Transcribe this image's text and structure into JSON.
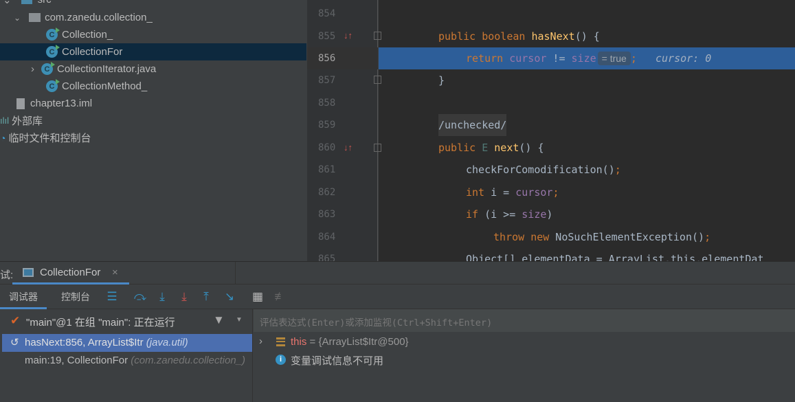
{
  "project_tree": {
    "items": [
      {
        "label": "src",
        "type": "folder"
      },
      {
        "label": "com.zanedu.collection_",
        "type": "package"
      },
      {
        "label": "Collection_",
        "type": "class"
      },
      {
        "label": "CollectionFor",
        "type": "class",
        "selected": true
      },
      {
        "label": "CollectionIterator.java",
        "type": "class"
      },
      {
        "label": "CollectionMethod_",
        "type": "class"
      },
      {
        "label": "chapter13.iml",
        "type": "file"
      },
      {
        "label": "外部库",
        "type": "library"
      },
      {
        "label": "临时文件和控制台",
        "type": "scratches"
      }
    ]
  },
  "editor": {
    "line_numbers": [
      "854",
      "855",
      "856",
      "857",
      "858",
      "859",
      "860",
      "861",
      "862",
      "863",
      "864",
      "865"
    ],
    "current_line": "856",
    "lines": {
      "l855": [
        "public",
        "boolean",
        "hasNext",
        "() {"
      ],
      "l856": [
        "return",
        "cursor",
        " != ",
        "size",
        "= true",
        ";",
        "cursor: 0"
      ],
      "l857": "}",
      "l859": "/unchecked/",
      "l860": [
        "public",
        "E",
        "next",
        "() {"
      ],
      "l861": [
        "checkForComodification()",
        ";"
      ],
      "l862": [
        "int",
        " i = ",
        "cursor",
        ";"
      ],
      "l863": [
        "if",
        " (i >= ",
        "size",
        ")"
      ],
      "l864": [
        "throw",
        "new",
        " NoSuchElementException()",
        ";"
      ],
      "l865": "Object[] elementData = ArrayList.this.elementDat"
    }
  },
  "debug": {
    "title_prefix": "试:",
    "session_tab": "CollectionFor",
    "tabs": [
      "调试器",
      "控制台"
    ],
    "active_tab": "调试器",
    "thread": "\"main\"@1 在组 \"main\": 正在运行",
    "eval_placeholder": "评估表达式(Enter)或添加监视(Ctrl+Shift+Enter)",
    "frames": [
      {
        "method": "hasNext:856, ArrayList$Itr",
        "pkg": "(java.util)",
        "selected": true
      },
      {
        "method": "main:19, CollectionFor",
        "pkg": "(com.zanedu.collection_)"
      }
    ],
    "variables": [
      {
        "name": "this",
        "value": "= {ArrayList$Itr@500}"
      },
      {
        "info": "变量调试信息不可用"
      }
    ]
  },
  "colors": {
    "selection": "#2d5e99",
    "keyword": "#cc7832",
    "field": "#9876aa",
    "method": "#ffc66d"
  }
}
